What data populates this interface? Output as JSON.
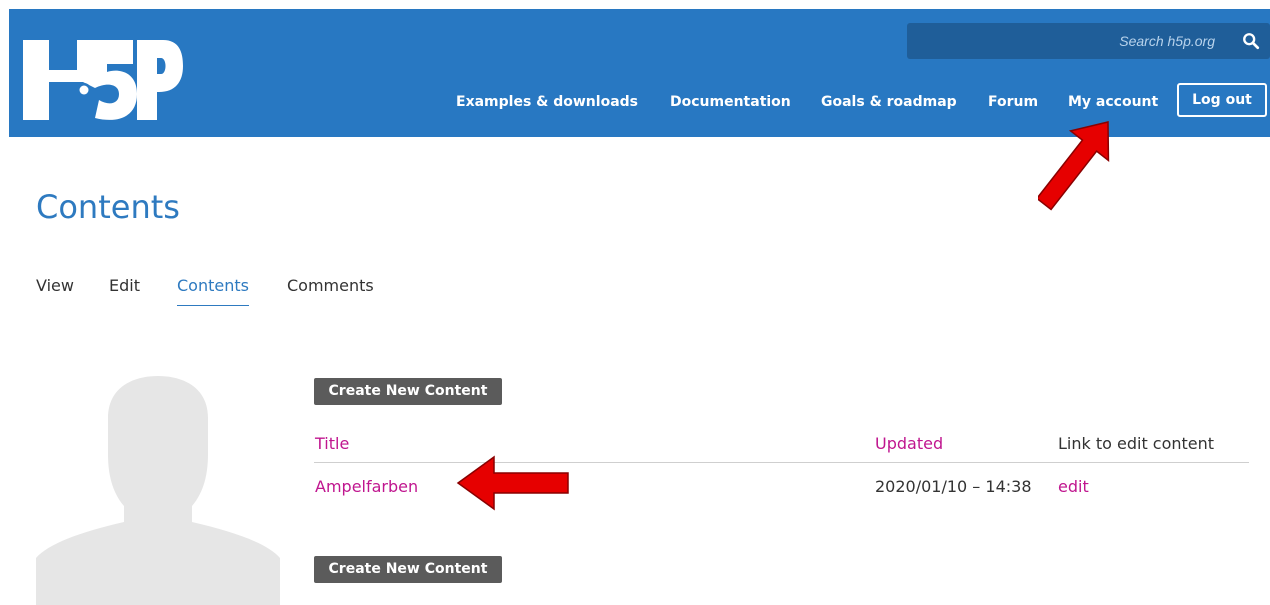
{
  "header": {
    "logo_text": "H5P",
    "search": {
      "placeholder": "Search h5p.org"
    },
    "nav": [
      {
        "label": "Examples & downloads"
      },
      {
        "label": "Documentation"
      },
      {
        "label": "Goals & roadmap"
      },
      {
        "label": "Forum"
      },
      {
        "label": "My account"
      }
    ],
    "logout_label": "Log out"
  },
  "page": {
    "title": "Contents",
    "tabs": [
      {
        "label": "View",
        "active": false
      },
      {
        "label": "Edit",
        "active": false
      },
      {
        "label": "Contents",
        "active": true
      },
      {
        "label": "Comments",
        "active": false
      }
    ]
  },
  "content": {
    "create_button_label": "Create New Content",
    "columns": [
      "Title",
      "Updated",
      "Link to edit content"
    ],
    "rows": [
      {
        "title": "Ampelfarben",
        "updated": "2020/01/10 – 14:38",
        "link": "edit"
      }
    ]
  },
  "colors": {
    "header_bg": "#2878c2",
    "search_bg": "#1f5e99",
    "title_blue": "#2e7ac0",
    "link_magenta": "#c0168f",
    "button_gray": "#5b5b5b",
    "annotation_red": "#e60000"
  },
  "icons": {
    "logo": "h5p-logo",
    "search": "search-icon",
    "avatar": "user-placeholder-avatar",
    "annotations": [
      "red-arrow-icon",
      "red-arrow-icon"
    ]
  }
}
